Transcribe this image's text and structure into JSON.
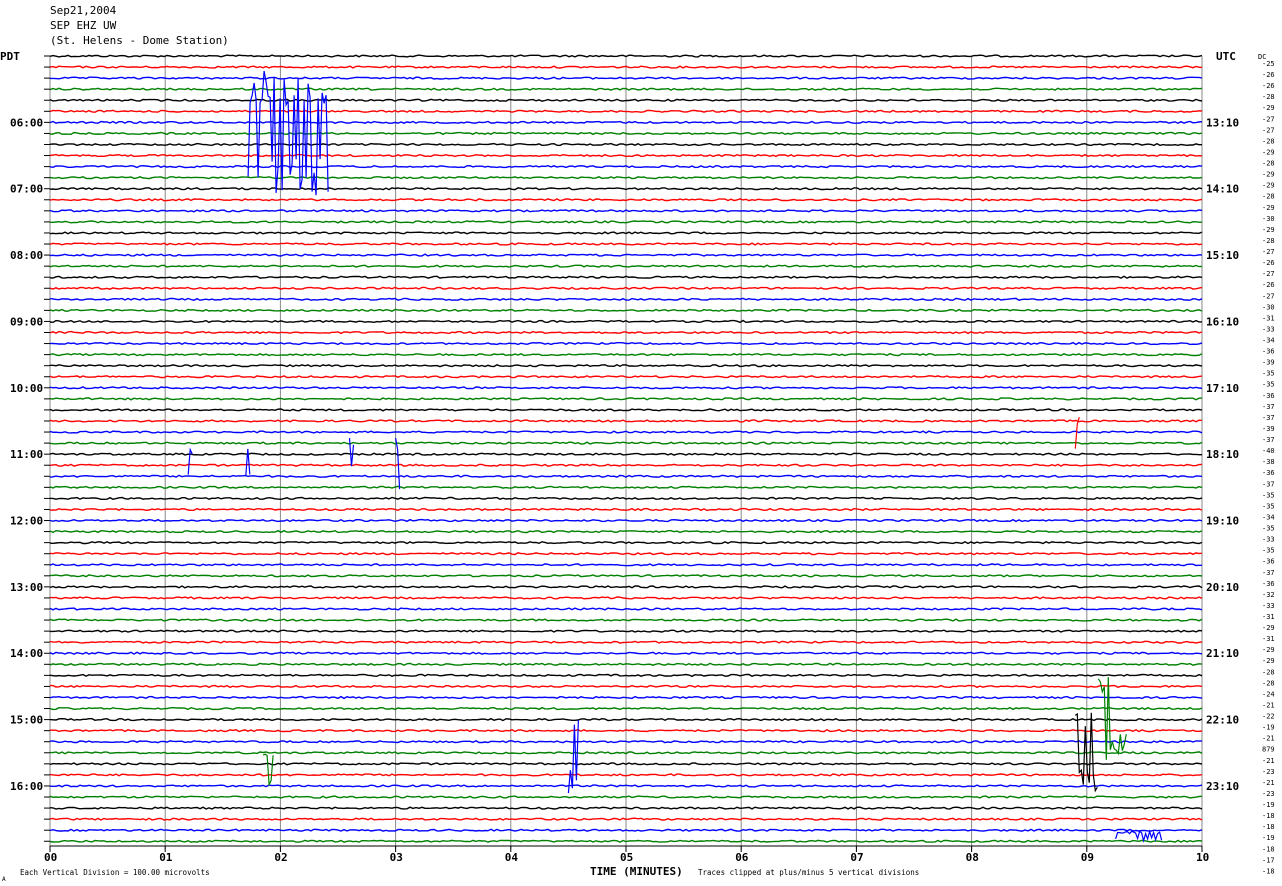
{
  "header": {
    "line1": "Sep21,2004",
    "line2": "SEP EHZ UW",
    "line3": "(St. Helens - Dome Station)"
  },
  "chart_data": {
    "type": "line",
    "left_axis_title": "PDT",
    "right_axis_title": "UTC",
    "dc_label": "DC",
    "left_time_labels": [
      "06:00",
      "07:00",
      "08:00",
      "09:00",
      "10:00",
      "11:00",
      "12:00",
      "13:00",
      "14:00",
      "15:00",
      "16:00"
    ],
    "right_time_labels": [
      "13:10",
      "14:10",
      "15:10",
      "16:10",
      "17:10",
      "18:10",
      "19:10",
      "20:10",
      "21:10",
      "22:10",
      "23:10"
    ],
    "x_tick_labels": [
      "00",
      "01",
      "02",
      "03",
      "04",
      "05",
      "06",
      "07",
      "08",
      "09",
      "10"
    ],
    "xlim": [
      0,
      10
    ],
    "xlabel": "TIME (MINUTES)",
    "trace_count": 72,
    "traces_per_hour": 6,
    "trace_color_cycle": [
      "#000000",
      "#ff0000",
      "#0000ff",
      "#008000"
    ],
    "dc_offsets": [
      26,
      -25,
      -26,
      -26,
      -28,
      -29,
      -27,
      -27,
      -28,
      -29,
      -28,
      -29,
      -29,
      -28,
      -29,
      -30,
      -29,
      -28,
      -27,
      -26,
      -27,
      -26,
      -27,
      -30,
      -31,
      -33,
      -34,
      -36,
      -39,
      -35,
      -35,
      -36,
      -37,
      -37,
      -39,
      -37,
      -40,
      -38,
      -36,
      -37,
      -35,
      -35,
      -34,
      -35,
      -33,
      -35,
      -36,
      -37,
      -36,
      -32,
      -33,
      -31,
      -29,
      -31,
      -29,
      -29,
      -28,
      -28,
      -24,
      -21,
      -22,
      -19,
      -21,
      879,
      -21,
      -23,
      -21,
      -23,
      -19,
      -18,
      -18,
      -19,
      -18,
      -17,
      -18
    ],
    "events": [
      {
        "traces": [
          2,
          12
        ],
        "minute": 1.72,
        "duration": 0.7,
        "amplitude": "clipped",
        "color": "#0000ff"
      },
      {
        "traces": [
          36,
          38
        ],
        "minute": 1.2,
        "duration": 0.05,
        "amplitude": "clipped",
        "color": "#0000ff"
      },
      {
        "traces": [
          36,
          38
        ],
        "minute": 1.7,
        "duration": 0.05,
        "amplitude": "clipped",
        "color": "#0000ff"
      },
      {
        "traces": [
          35,
          37
        ],
        "minute": 2.6,
        "duration": 0.05,
        "amplitude": "clipped",
        "color": "#0000ff"
      },
      {
        "traces": [
          35,
          39
        ],
        "minute": 3.0,
        "duration": 0.05,
        "amplitude": "clipped",
        "color": "#0000ff"
      },
      {
        "traces": [
          33,
          35
        ],
        "minute": 8.9,
        "duration": 0.05,
        "amplitude": "clipped",
        "color": "#ff0000"
      },
      {
        "traces": [
          63,
          66
        ],
        "minute": 1.85,
        "duration": 0.1,
        "amplitude": "clipped",
        "color": "#008000"
      },
      {
        "traces": [
          56,
          63
        ],
        "minute": 9.1,
        "duration": 0.25,
        "amplitude": "clipped",
        "color": "#008000"
      },
      {
        "traces": [
          59,
          66
        ],
        "minute": 4.5,
        "duration": 0.1,
        "amplitude": "clipped",
        "color": "#0000ff"
      },
      {
        "traces": [
          60,
          66
        ],
        "minute": 8.9,
        "duration": 0.2,
        "amplitude": "clipped",
        "color": "#000000"
      },
      {
        "traces": [
          70,
          71
        ],
        "minute": 9.25,
        "duration": 0.4,
        "amplitude": "small",
        "color": "#0000ff"
      }
    ]
  },
  "footer": {
    "left_note": "Each Vertical Division =  100.00 microvolts",
    "right_note": "Traces clipped at plus/minus 5 vertical divisions",
    "corner_mark": "A"
  }
}
